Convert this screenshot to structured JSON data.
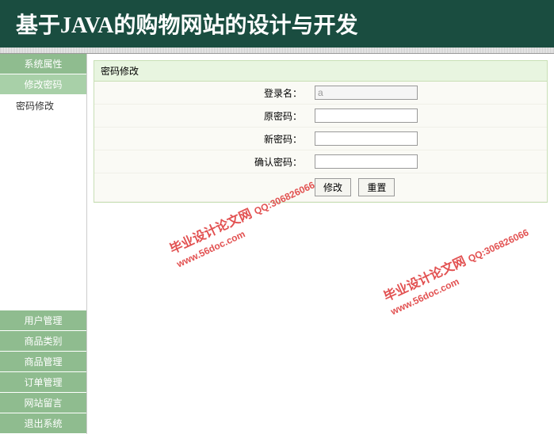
{
  "header": {
    "title": "基于JAVA的购物网站的设计与开发"
  },
  "sidebar": {
    "top": [
      {
        "label": "系统属性",
        "type": "section"
      },
      {
        "label": "修改密码",
        "type": "section-light"
      },
      {
        "label": "密码修改",
        "type": "item"
      }
    ],
    "bottom": [
      {
        "label": "用户管理",
        "type": "section"
      },
      {
        "label": "商品类别",
        "type": "section"
      },
      {
        "label": "商品管理",
        "type": "section"
      },
      {
        "label": "订单管理",
        "type": "section"
      },
      {
        "label": "网站留言",
        "type": "section"
      },
      {
        "label": "退出系统",
        "type": "section"
      }
    ]
  },
  "panel": {
    "title": "密码修改",
    "fields": {
      "username_label": "登录名：",
      "username_value": "a",
      "old_pwd_label": "原密码：",
      "new_pwd_label": "新密码：",
      "confirm_pwd_label": "确认密码："
    },
    "buttons": {
      "modify": "修改",
      "reset": "重置"
    }
  },
  "watermark": {
    "text": "毕业设计论文网",
    "qq": "QQ:306826066",
    "url": "www.56doc.com"
  }
}
